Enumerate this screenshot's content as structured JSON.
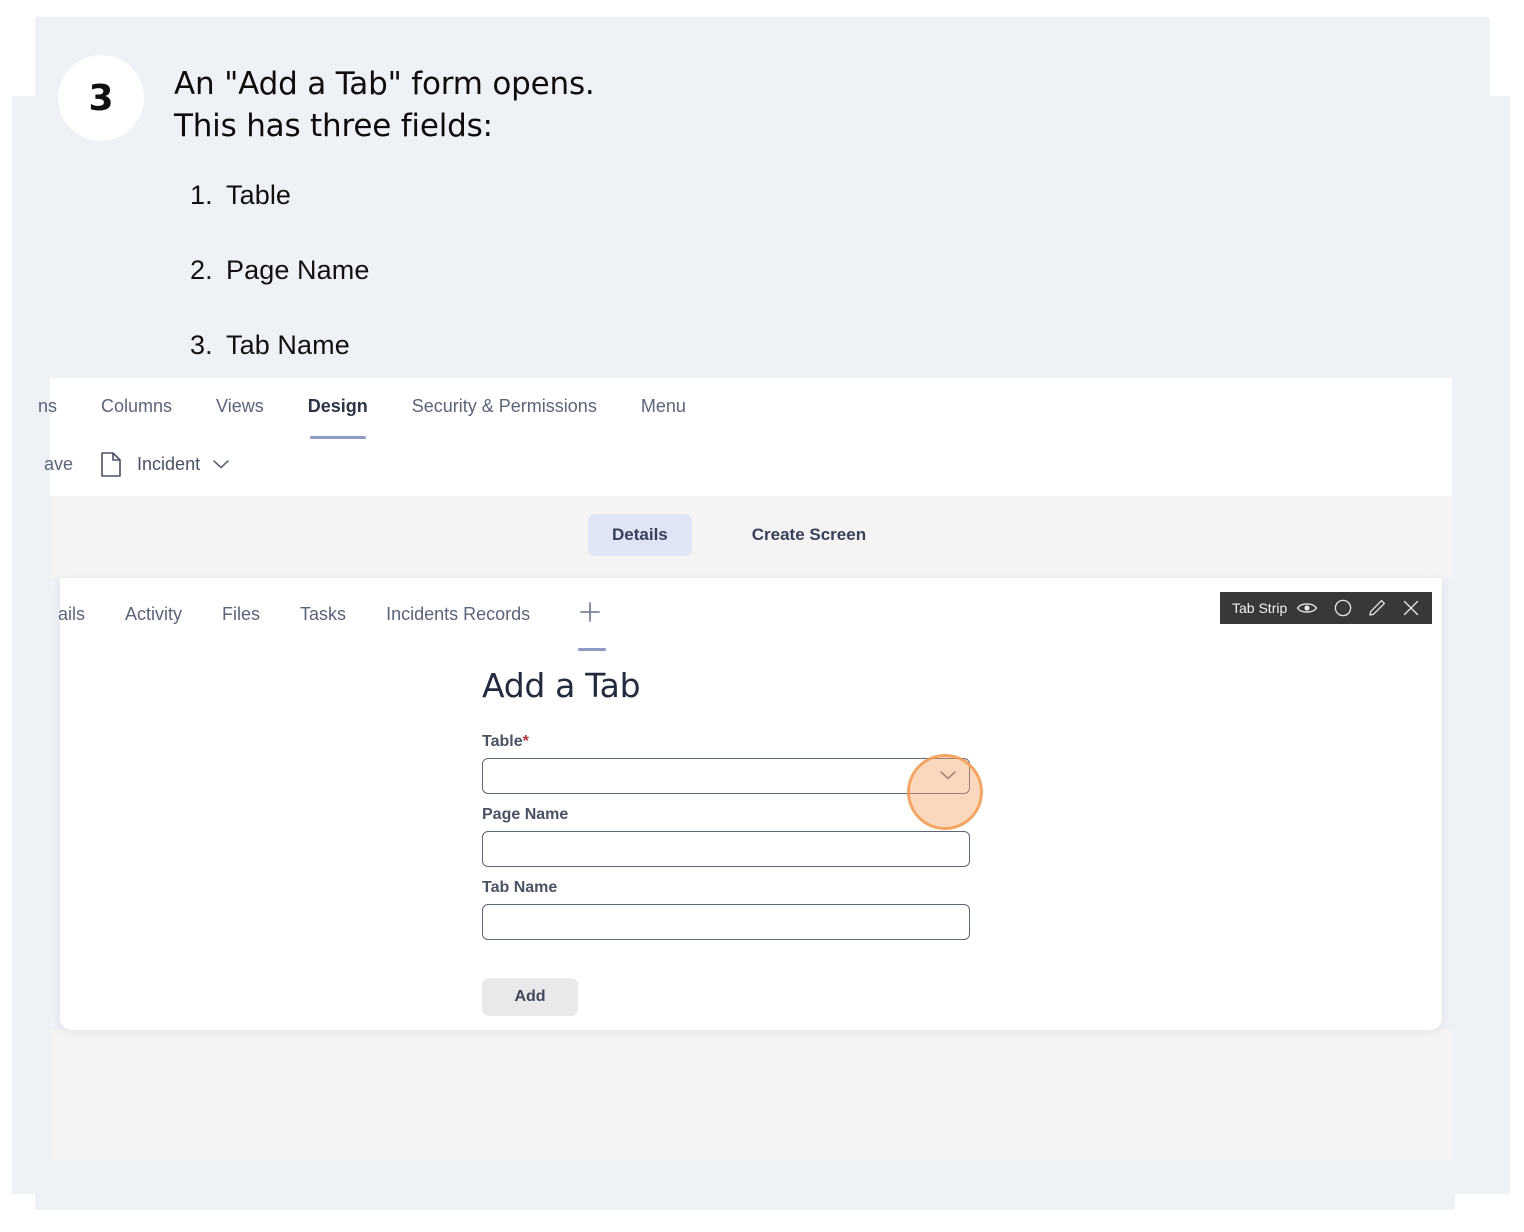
{
  "step": {
    "number": "3",
    "text": "An \"Add a Tab\" form opens.\nThis has three fields:",
    "list": [
      {
        "num": "1.",
        "label": "Table"
      },
      {
        "num": "2.",
        "label": "Page Name"
      },
      {
        "num": "3.",
        "label": "Tab Name"
      }
    ]
  },
  "app": {
    "top_tabs": [
      {
        "label": "ns",
        "active": false
      },
      {
        "label": "Columns",
        "active": false
      },
      {
        "label": "Views",
        "active": false
      },
      {
        "label": "Design",
        "active": true
      },
      {
        "label": "Security & Permissions",
        "active": false
      },
      {
        "label": "Menu",
        "active": false
      }
    ],
    "subbar": {
      "save_label": "ave",
      "record_label": "Incident",
      "doc_icon": "document-icon",
      "chevron_icon": "chevron-down-icon"
    },
    "segmented": {
      "selected": "Details",
      "other": "Create Screen"
    },
    "inner_tabs": [
      {
        "label": "ails"
      },
      {
        "label": "Activity"
      },
      {
        "label": "Files"
      },
      {
        "label": "Tasks"
      },
      {
        "label": "Incidents Records"
      }
    ],
    "add_tab_glyph": "+",
    "tabstrip": {
      "label": "Tab Strip",
      "icons": [
        "eye-icon",
        "circle-icon",
        "pencil-icon",
        "close-icon"
      ]
    }
  },
  "form": {
    "title": "Add a Tab",
    "fields": [
      {
        "label": "Table",
        "required_marker": "*",
        "value": "",
        "type": "select"
      },
      {
        "label": "Page Name",
        "required_marker": "",
        "value": "",
        "type": "text"
      },
      {
        "label": "Tab Name",
        "required_marker": "",
        "value": "",
        "type": "text"
      }
    ],
    "submit_label": "Add"
  },
  "colors": {
    "panel_bg": "#eef1f6",
    "accent_underline": "#8d9bc4",
    "segment_selected_bg": "#dfe5f5",
    "highlight_ring": "#f39c54",
    "required_star": "#b3343f",
    "toolbar_bg": "#383838"
  }
}
